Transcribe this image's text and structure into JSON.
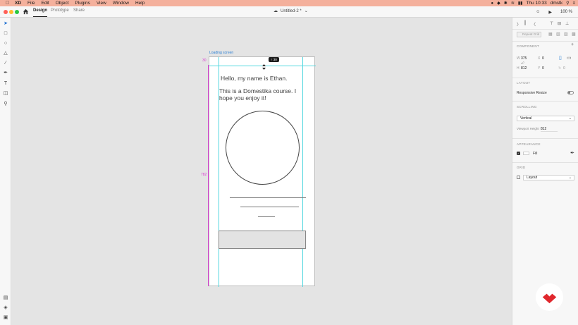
{
  "menubar": {
    "app": "XD",
    "items": [
      "File",
      "Edit",
      "Object",
      "Plugins",
      "View",
      "Window",
      "Help"
    ],
    "clock": "Thu 10:33",
    "user": "dmstk"
  },
  "header": {
    "tabs": [
      "Design",
      "Prototype",
      "Share"
    ],
    "document_title": "Untitled-2 *",
    "zoom": "100 %"
  },
  "canvas": {
    "artboard_name": "Loading screen",
    "guide_label_top": "30",
    "guide_label_height": "782",
    "distance_badge": "↑ 30",
    "heading": "Hello, my name is Ethan.",
    "subtext": "This is a Domestika course. I hope you enjoy it!"
  },
  "inspector": {
    "repeat_grid": "Repeat Grid",
    "component_label": "COMPONENT",
    "w_label": "W",
    "w_value": "375",
    "x_label": "X",
    "x_value": "0",
    "h_label": "H",
    "h_value": "812",
    "y_label": "Y",
    "y_value": "0",
    "rotation": "0",
    "layout_label": "LAYOUT",
    "responsive_resize": "Responsive Resize",
    "scrolling_label": "SCROLLING",
    "scrolling_value": "Vertical",
    "viewport_label": "Viewport Height",
    "viewport_value": "812",
    "appearance_label": "APPEARANCE",
    "fill_label": "Fill",
    "grid_label": "GRID",
    "grid_value": "Layout"
  },
  "colors": {
    "menubar_bg": "#f4b09c",
    "guide": "#54d7e0",
    "guide_label": "#d83bd2",
    "artboard_label": "#2a7fd4",
    "domestika_red": "#e0272d"
  }
}
